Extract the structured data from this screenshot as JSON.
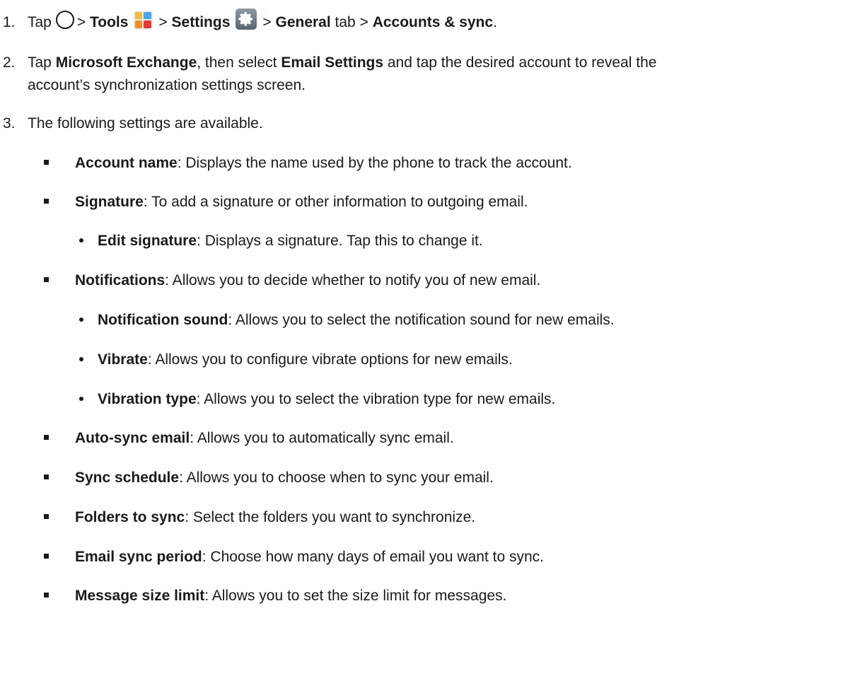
{
  "steps": [
    {
      "number": "1.",
      "tap": "Tap",
      "sep1": ">",
      "tools": "Tools",
      "sep2": ">",
      "settings": "Settings",
      "sep3": ">",
      "general": "General",
      "tab": "tab >",
      "accounts": "Accounts & sync",
      "end": "."
    },
    {
      "number": "2.",
      "t1": "Tap",
      "b1": "Microsoft Exchange",
      "t2": ", then select",
      "b2": "Email Settings",
      "t3": "and tap the desired account to reveal the",
      "line2": "account’s synchronization settings screen."
    },
    {
      "number": "3.",
      "text": "The following settings are available."
    }
  ],
  "settings": [
    {
      "level": 1,
      "term": "Account name",
      "desc": ": Displays the name used by the phone to track the account."
    },
    {
      "level": 1,
      "term": "Signature",
      "desc": ": To add a signature or other information to outgoing email."
    },
    {
      "level": 2,
      "term": "Edit signature",
      "desc": ": Displays a signature. Tap this to change it."
    },
    {
      "level": 1,
      "term": "Notifications",
      "desc": ": Allows you to decide whether to notify you of new email."
    },
    {
      "level": 2,
      "term": "Notification sound",
      "desc": ": Allows you to select the notification sound for new emails."
    },
    {
      "level": 2,
      "term": "Vibrate",
      "desc": ": Allows you to configure vibrate options for new emails."
    },
    {
      "level": 2,
      "term": "Vibration type",
      "desc": ": Allows you to select the vibration type for new emails."
    },
    {
      "level": 1,
      "term": "Auto-sync email",
      "desc": ": Allows you to automatically sync email."
    },
    {
      "level": 1,
      "term": "Sync schedule",
      "desc": ": Allows you to choose when to sync your email."
    },
    {
      "level": 1,
      "term": "Folders to sync",
      "desc": ": Select the folders you want to synchronize."
    },
    {
      "level": 1,
      "term": "Email sync period",
      "desc": ": Choose how many days of email you want to sync."
    },
    {
      "level": 1,
      "term": "Message size limit",
      "desc": ": Allows you to set the size limit for messages."
    }
  ],
  "icons": {
    "home": "home-circle-icon",
    "tools": "tools-app-icon",
    "settings": "settings-gear-icon"
  }
}
